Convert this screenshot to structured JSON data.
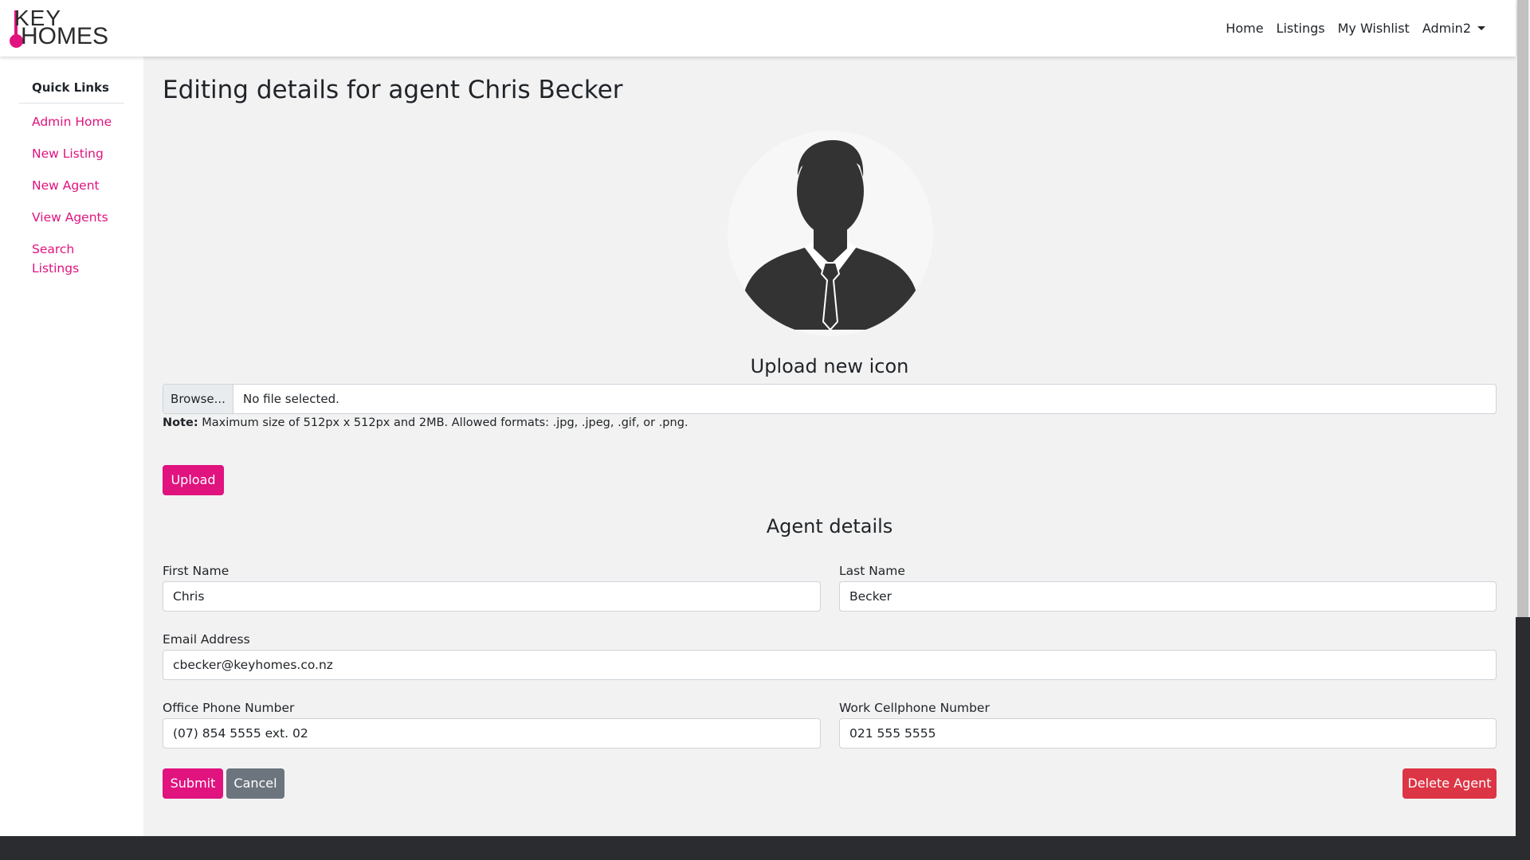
{
  "brand": {
    "line1": "KEY",
    "line2": "HOMES",
    "accent_color": "#e0137f"
  },
  "nav": {
    "items": [
      "Home",
      "Listings",
      "My Wishlist"
    ],
    "user_menu": "Admin2"
  },
  "sidebar": {
    "heading": "Quick Links",
    "links": [
      "Admin Home",
      "New Listing",
      "New Agent",
      "View Agents",
      "Search Listings"
    ]
  },
  "page": {
    "title": "Editing details for agent Chris Becker"
  },
  "avatar": {
    "icon": "person-silhouette-icon"
  },
  "upload": {
    "heading": "Upload new icon",
    "browse_label": "Browse...",
    "file_status": "No file selected.",
    "note_label": "Note:",
    "note_text": " Maximum size of 512px x 512px and 2MB. Allowed formats: .jpg, .jpeg, .gif, or .png.",
    "button_label": "Upload"
  },
  "agent_details": {
    "heading": "Agent details",
    "first_name": {
      "label": "First Name",
      "value": "Chris"
    },
    "last_name": {
      "label": "Last Name",
      "value": "Becker"
    },
    "email": {
      "label": "Email Address",
      "value": "cbecker@keyhomes.co.nz"
    },
    "office_phone": {
      "label": "Office Phone Number",
      "value": "(07) 854 5555 ext. 02"
    },
    "cell_phone": {
      "label": "Work Cellphone Number",
      "value": "021 555 5555"
    }
  },
  "actions": {
    "submit_label": "Submit",
    "cancel_label": "Cancel",
    "delete_label": "Delete Agent"
  },
  "colors": {
    "primary": "#e0137f",
    "secondary": "#6c757d",
    "danger": "#dc3545",
    "footer": "#2a2c30"
  }
}
